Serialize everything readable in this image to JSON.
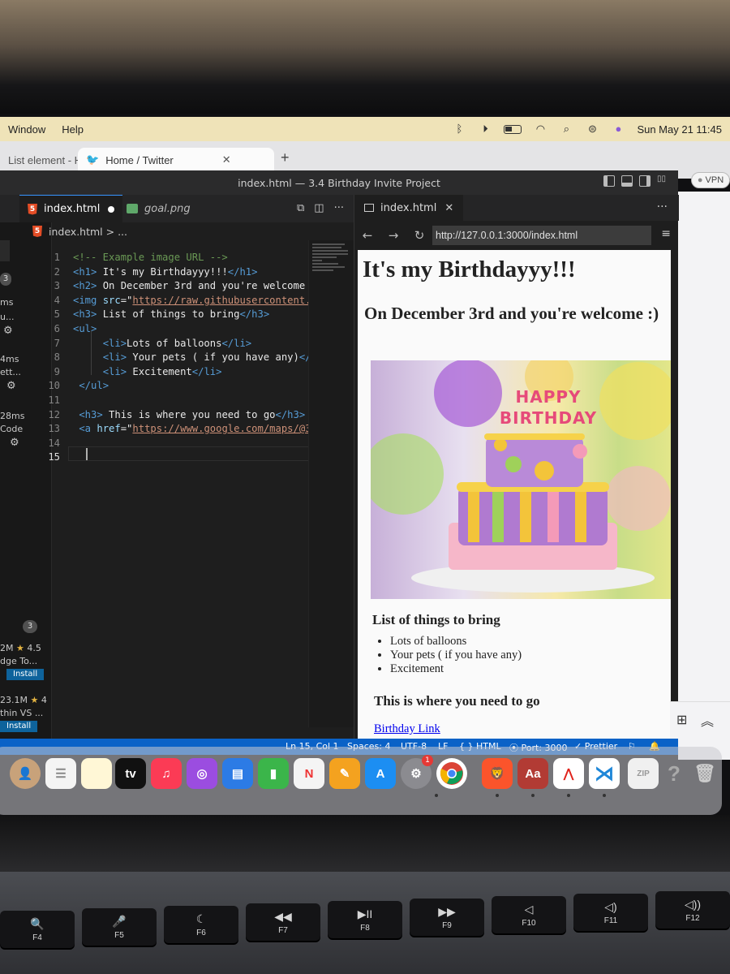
{
  "menubar": {
    "items": [
      "Window",
      "Help"
    ],
    "datetime": "Sun May 21  11:45"
  },
  "browser": {
    "tabs": [
      {
        "label": "List element - H"
      },
      {
        "label": "Home / Twitter"
      }
    ],
    "vpn_label": "VPN"
  },
  "vscode": {
    "title": "index.html — 3.4 Birthday Invite Project",
    "editor_tabs": [
      {
        "label": "index.html"
      },
      {
        "label": "goal.png"
      }
    ],
    "breadcrumb": "index.html > ...",
    "cursor_line": "15",
    "code_lines": [
      {
        "n": "1",
        "html": "<span class='c-com'>&lt;!-- Example image URL --&gt;</span>"
      },
      {
        "n": "2",
        "html": "<span class='c-tag'>&lt;h1&gt;</span><span class='c-txt'> It's my Birthdayyy!!!</span><span class='c-tag'>&lt;/h1&gt;</span>"
      },
      {
        "n": "3",
        "html": "<span class='c-tag'>&lt;h2&gt;</span><span class='c-txt'> On December 3rd and you're welcome :</span>"
      },
      {
        "n": "4",
        "html": "<span class='c-tag'>&lt;img </span><span class='c-attr'>src</span><span class='c-txt'>=\"</span><span class='c-str'>https://raw.githubusercontent.c</span>"
      },
      {
        "n": "5",
        "html": "<span class='c-tag'>&lt;h3&gt;</span><span class='c-txt'> List of things to bring</span><span class='c-tag'>&lt;/h3&gt;</span>"
      },
      {
        "n": "6",
        "html": "<span class='c-tag'>&lt;ul&gt;</span>"
      },
      {
        "n": "7",
        "html": "     <span class='c-tag'>&lt;li&gt;</span><span class='c-txt'>Lots of balloons</span><span class='c-tag'>&lt;/li&gt;</span>"
      },
      {
        "n": "8",
        "html": "     <span class='c-tag'>&lt;li&gt;</span><span class='c-txt'> Your pets ( if you have any)</span><span class='c-tag'>&lt;/li</span>"
      },
      {
        "n": "9",
        "html": "     <span class='c-tag'>&lt;li&gt;</span><span class='c-txt'> Excitement</span><span class='c-tag'>&lt;/li&gt;</span>"
      },
      {
        "n": "10",
        "html": " <span class='c-tag'>&lt;/ul&gt;</span>"
      },
      {
        "n": "11",
        "html": ""
      },
      {
        "n": "12",
        "html": " <span class='c-tag'>&lt;h3&gt;</span><span class='c-txt'> This is where you need to go</span><span class='c-tag'>&lt;/h3&gt;</span>"
      },
      {
        "n": "13",
        "html": " <span class='c-tag'>&lt;a </span><span class='c-attr'>href</span><span class='c-txt'>=\"</span><span class='c-str'>https://www.google.com/maps/@35.</span>"
      },
      {
        "n": "14",
        "html": ""
      },
      {
        "n": "15",
        "html": ""
      }
    ],
    "sidebar": {
      "badge_top": "3",
      "timings": [
        "ms",
        "4ms",
        "28ms"
      ],
      "snippets": [
        "u...",
        "ett...",
        "Code"
      ],
      "badge_ext": "3",
      "ext1": {
        "downloads": "2M",
        "rating": "4.5",
        "name": "dge To...",
        "install": "Install"
      },
      "ext2": {
        "downloads": "23.1M",
        "rating": "4",
        "name": "thin VS ...",
        "install": "Install"
      }
    },
    "preview": {
      "tab_label": "index.html",
      "url": "http://127.0.0.1:3000/index.html",
      "h1": "It's my Birthdayyy!!!",
      "h2": "On December 3rd and you're welcome :)",
      "cake_text": "HAPPY BIRTHDAY",
      "h3_list": "List of things to bring",
      "list": [
        "Lots of balloons",
        "Your pets ( if you have any)",
        "Excitement"
      ],
      "h3_go": "This is where you need to go",
      "link": "Birthday Link"
    },
    "status": {
      "position": "Ln 15, Col 1",
      "spaces": "Spaces: 4",
      "encoding": "UTF-8",
      "eol": "LF",
      "language": "{ } HTML",
      "port": "Port: 3000",
      "prettier": "✓ Prettier"
    }
  },
  "dock": {
    "tv_label": "tv",
    "dictionary_label": "Aa",
    "store_badge": "1"
  },
  "keyboard": {
    "keys": [
      {
        "glyph": "🔍",
        "label": "F4"
      },
      {
        "glyph": "🎤",
        "label": "F5"
      },
      {
        "glyph": "☾",
        "label": "F6"
      },
      {
        "glyph": "◀◀",
        "label": "F7"
      },
      {
        "glyph": "▶II",
        "label": "F8"
      },
      {
        "glyph": "▶▶",
        "label": "F9"
      },
      {
        "glyph": "◁",
        "label": "F10"
      },
      {
        "glyph": "◁)",
        "label": "F11"
      },
      {
        "glyph": "◁))",
        "label": "F12"
      }
    ]
  }
}
